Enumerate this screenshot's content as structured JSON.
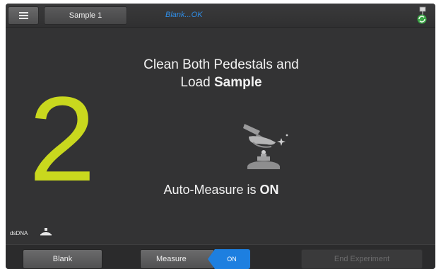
{
  "topbar": {
    "sample_label": "Sample 1",
    "status_text": "Blank...OK"
  },
  "step": {
    "number": "2",
    "color": "#c9d81e"
  },
  "instruction": {
    "line1": "Clean Both Pedestals and",
    "line2_prefix": "Load ",
    "line2_bold": "Sample"
  },
  "auto_measure": {
    "prefix": "Auto-Measure is ",
    "state": "ON"
  },
  "assay": {
    "label": "dsDNA"
  },
  "bottombar": {
    "blank_label": "Blank",
    "measure_label": "Measure",
    "measure_toggle": "ON",
    "end_label": "End Experiment"
  },
  "colors": {
    "accent_blue": "#1d7fe0",
    "status_blue": "#2f8ee8"
  }
}
